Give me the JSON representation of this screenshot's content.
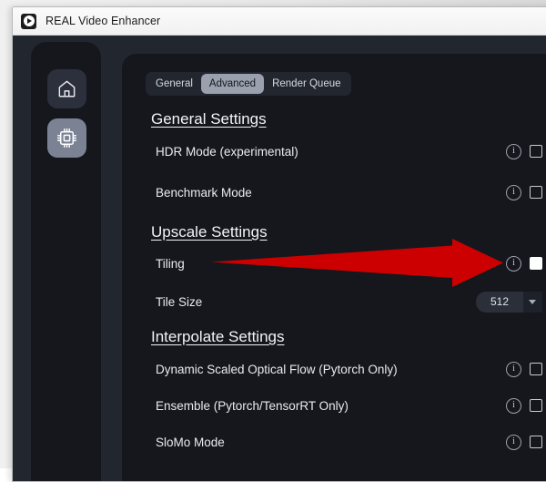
{
  "window": {
    "title": "REAL Video Enhancer",
    "app_icon": "play-circle-icon"
  },
  "sidebar": {
    "items": [
      {
        "name": "home",
        "icon": "home-icon",
        "selected": false
      },
      {
        "name": "processing",
        "icon": "cpu-chip-icon",
        "selected": true
      }
    ]
  },
  "tabs": [
    {
      "label": "General",
      "active": false
    },
    {
      "label": "Advanced",
      "active": true
    },
    {
      "label": "Render Queue",
      "active": false
    }
  ],
  "sections": [
    {
      "heading": "General Settings",
      "rows": [
        {
          "label": "HDR Mode (experimental)",
          "control": "checkbox",
          "checked": false,
          "info": true
        },
        {
          "label": "Benchmark Mode",
          "control": "checkbox",
          "checked": false,
          "info": true
        }
      ]
    },
    {
      "heading": "Upscale Settings",
      "rows": [
        {
          "label": "Tiling",
          "control": "checkbox",
          "checked": true,
          "info": true
        },
        {
          "label": "Tile Size",
          "control": "dropdown",
          "value": "512",
          "info": false
        }
      ]
    },
    {
      "heading": "Interpolate Settings",
      "rows": [
        {
          "label": "Dynamic Scaled Optical Flow (Pytorch Only)",
          "control": "checkbox",
          "checked": false,
          "info": true
        },
        {
          "label": "Ensemble (Pytorch/TensorRT Only)",
          "control": "checkbox",
          "checked": false,
          "info": true
        },
        {
          "label": "SloMo Mode",
          "control": "checkbox",
          "checked": false,
          "info": true
        }
      ]
    }
  ],
  "annotation": {
    "type": "arrow",
    "color": "#cc0000",
    "points_to": "Tiling checkbox"
  },
  "colors": {
    "panel_bg": "#15171d",
    "frame_bg": "#22262f",
    "tab_active_bg": "#9aa0ad",
    "text": "#e9ebef",
    "arrow_red": "#cc0000"
  }
}
